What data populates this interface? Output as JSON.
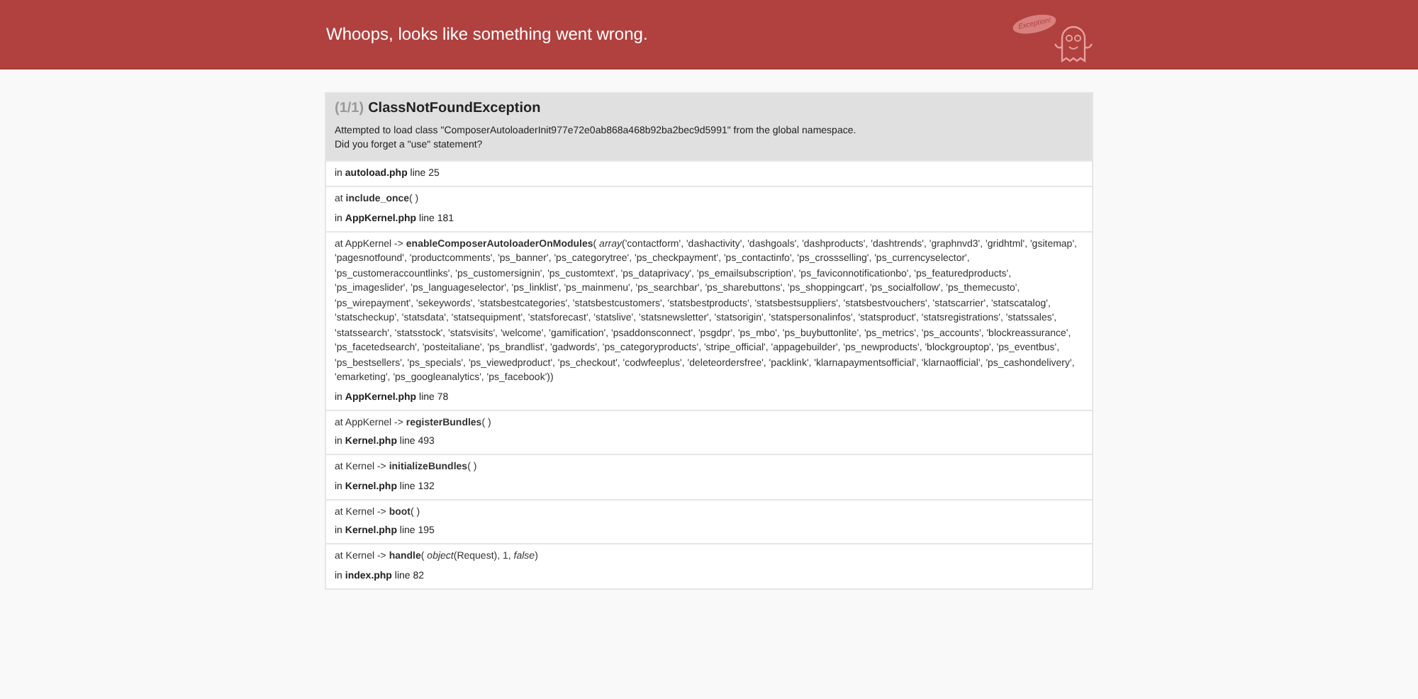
{
  "header": {
    "title": "Whoops, looks like something went wrong.",
    "logo_text": "Exception!"
  },
  "exception": {
    "counter": "(1/1)",
    "name": "ClassNotFoundException",
    "message": [
      "Attempted to load class \"ComposerAutoloaderInit977e72e0ab868a468b92ba2bec9d5991\" from the global namespace.",
      "Did you forget a \"use\" statement?"
    ]
  },
  "frames": [
    {
      "location": "in **autoload.php** line 25"
    },
    {
      "call": "at  **include_once**( )",
      "location": "in **AppKernel.php** line 181"
    },
    {
      "call": "at AppKernel -> **enableComposerAutoloaderOnModules**( *array*('contactform', 'dashactivity', 'dashgoals', 'dashproducts', 'dashtrends', 'graphnvd3', 'gridhtml', 'gsitemap', 'pagesnotfound', 'productcomments', 'ps_banner', 'ps_categorytree', 'ps_checkpayment', 'ps_contactinfo', 'ps_crossselling', 'ps_currencyselector', 'ps_customeraccountlinks', 'ps_customersignin', 'ps_customtext', 'ps_dataprivacy', 'ps_emailsubscription', 'ps_faviconnotificationbo', 'ps_featuredproducts', 'ps_imageslider', 'ps_languageselector', 'ps_linklist', 'ps_mainmenu', 'ps_searchbar', 'ps_sharebuttons', 'ps_shoppingcart', 'ps_socialfollow', 'ps_themecusto', 'ps_wirepayment', 'sekeywords', 'statsbestcategories', 'statsbestcustomers', 'statsbestproducts', 'statsbestsuppliers', 'statsbestvouchers', 'statscarrier', 'statscatalog', 'statscheckup', 'statsdata', 'statsequipment', 'statsforecast', 'statslive', 'statsnewsletter', 'statsorigin', 'statspersonalinfos', 'statsproduct', 'statsregistrations', 'statssales', 'statssearch', 'statsstock', 'statsvisits', 'welcome', 'gamification', 'psaddonsconnect', 'psgdpr', 'ps_mbo', 'ps_buybuttonlite', 'ps_metrics', 'ps_accounts', 'blockreassurance', 'ps_facetedsearch', 'posteitaliane', 'ps_brandlist', 'gadwords', 'ps_categoryproducts', 'stripe_official', 'appagebuilder', 'ps_newproducts', 'blockgrouptop', 'ps_eventbus', 'ps_bestsellers', 'ps_specials', 'ps_viewedproduct', 'ps_checkout', 'codwfeeplus', 'deleteordersfree', 'packlink', 'klarnapaymentsofficial', 'klarnaofficial', 'ps_cashondelivery', 'emarketing', 'ps_googleanalytics', 'ps_facebook'))",
      "location": "in **AppKernel.php** line 78"
    },
    {
      "call": "at AppKernel -> **registerBundles**( )",
      "location": "in **Kernel.php** line 493"
    },
    {
      "call": "at Kernel -> **initializeBundles**( )",
      "location": "in **Kernel.php** line 132"
    },
    {
      "call": "at Kernel -> **boot**( )",
      "location": "in **Kernel.php** line 195"
    },
    {
      "call": "at Kernel -> **handle**( *object*(Request), 1, *false*)",
      "location": "in **index.php** line 82"
    }
  ]
}
